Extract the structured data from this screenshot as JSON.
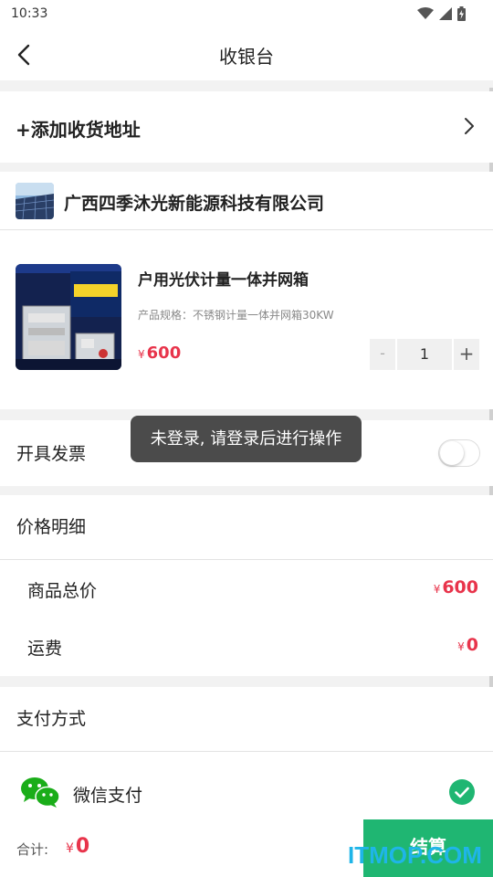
{
  "status_bar": {
    "time": "10:33"
  },
  "nav": {
    "title": "收银台"
  },
  "address": {
    "label": "+添加收货地址"
  },
  "shop": {
    "name": "广西四季沐光新能源科技有限公司"
  },
  "product": {
    "title": "户用光伏计量一体并网箱",
    "spec": "产品规格：不锈钢计量一体并网箱30KW",
    "currency": "¥",
    "price": "600",
    "quantity": "1",
    "minus_label": "-",
    "plus_label": "+"
  },
  "invoice": {
    "label": "开具发票",
    "enabled": false
  },
  "toast": {
    "message": "未登录, 请登录后进行操作"
  },
  "price_detail": {
    "title": "价格明细",
    "goods_total_label": "商品总价",
    "goods_total_currency": "¥",
    "goods_total_value": "600",
    "shipping_label": "运费",
    "shipping_currency": "¥",
    "shipping_value": "0"
  },
  "payment": {
    "title": "支付方式",
    "method_label": "微信支付",
    "method_selected": true
  },
  "bottom": {
    "total_label": "合计:",
    "total_currency": "¥",
    "total_value": "0",
    "checkout_label": "结算"
  },
  "watermark": "ITMOP.COM",
  "colors": {
    "accent_green": "#1fb672",
    "price_red": "#e8344b",
    "watermark_blue": "#1fb5e8"
  }
}
